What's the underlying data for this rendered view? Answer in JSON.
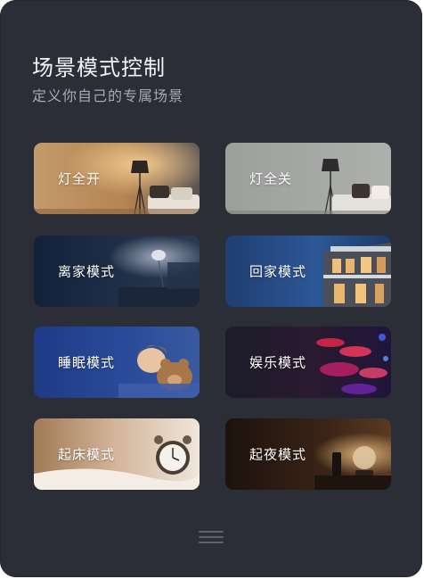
{
  "header": {
    "title": "场景模式控制",
    "subtitle": "定义你自己的专属场景"
  },
  "scenes": [
    {
      "label": "灯全开",
      "image": "lit-living-room-lamp"
    },
    {
      "label": "灯全关",
      "image": "unlit-living-room-lamp"
    },
    {
      "label": "离家模式",
      "image": "dark-room-empty"
    },
    {
      "label": "回家模式",
      "image": "house-at-dusk"
    },
    {
      "label": "睡眠模式",
      "image": "child-sleeping-with-teddy-bear"
    },
    {
      "label": "娱乐模式",
      "image": "colorful-party-lights"
    },
    {
      "label": "起床模式",
      "image": "alarm-clock-on-bed"
    },
    {
      "label": "起夜模式",
      "image": "night-lamp"
    }
  ],
  "footer": {
    "icon": "menu-icon"
  }
}
